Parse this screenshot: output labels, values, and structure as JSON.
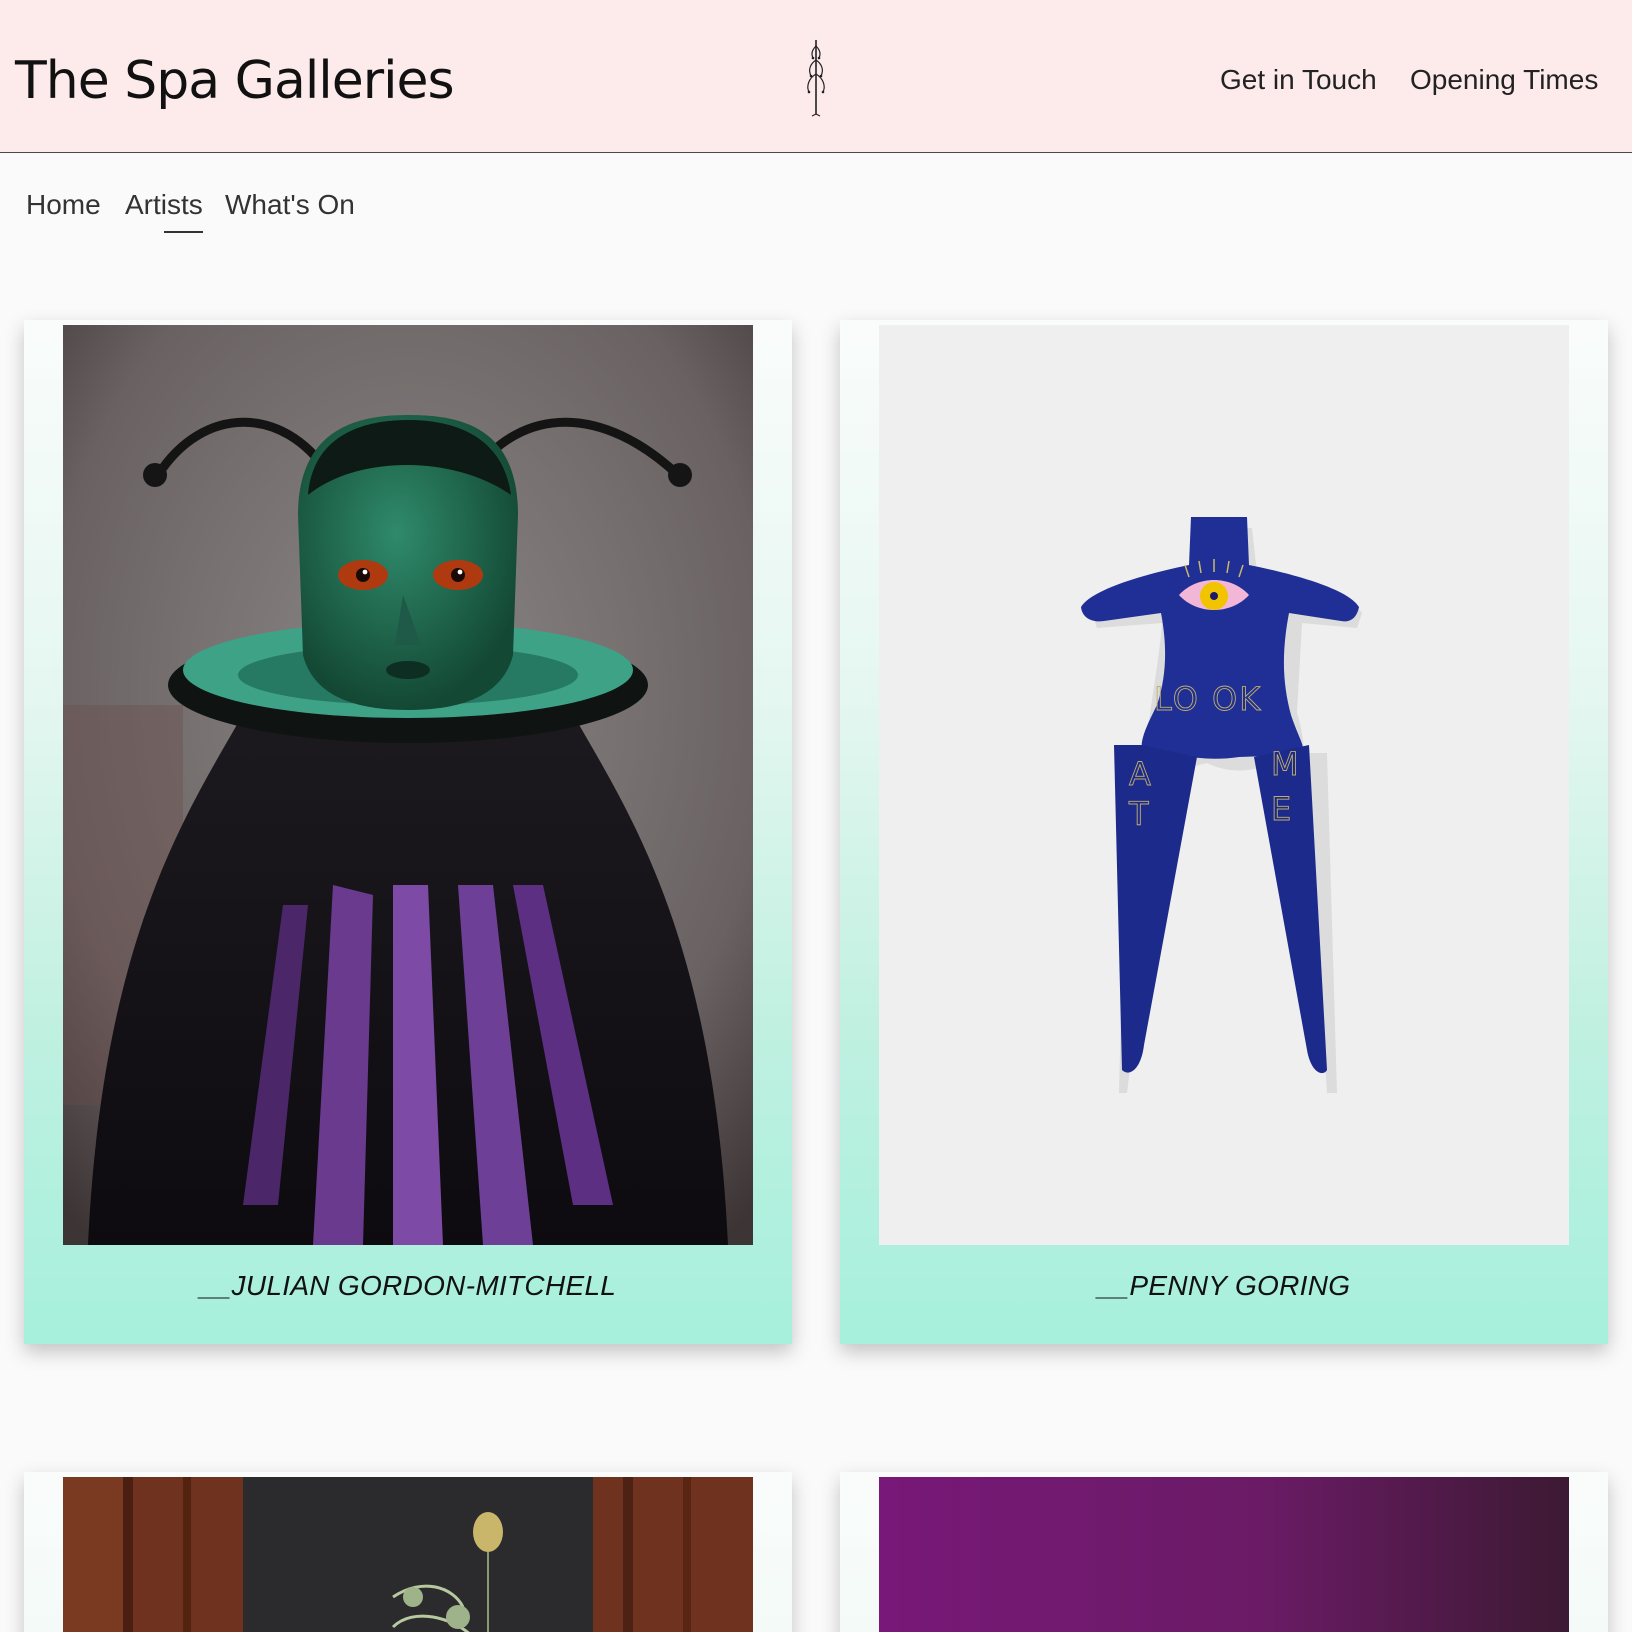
{
  "header": {
    "site_title": "The Spa Galleries",
    "links": {
      "get_in_touch": "Get in Touch",
      "opening_times": "Opening Times"
    },
    "background_color": "#fdebec"
  },
  "subnav": {
    "items": [
      {
        "label": "Home"
      },
      {
        "label": "Artists",
        "active": true
      },
      {
        "label": "What's On"
      }
    ]
  },
  "artists": [
    {
      "name": "__JULIAN GORDON-MITCHELL",
      "image": "painting-green-faced-figure"
    },
    {
      "name": "__PENNY GORING",
      "image": "blue-velvet-doll-look-at-me"
    },
    {
      "name": "",
      "image": "painted-slate-flowers"
    },
    {
      "name": "",
      "image": "purple-gradient"
    }
  ],
  "colors": {
    "card_gradient_bottom": "#a6f0dc",
    "page_background": "#fafafa"
  }
}
